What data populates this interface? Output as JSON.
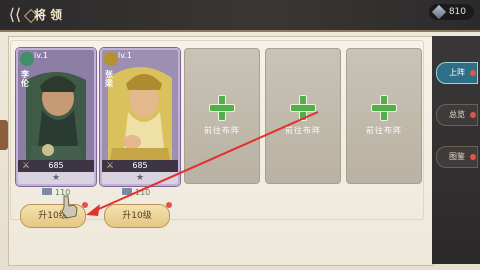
{
  "header": {
    "title": "将领",
    "back_icon": "back-arrow-icon",
    "currency": {
      "icon": "silver-gem-icon",
      "value": "810"
    }
  },
  "heroes": [
    {
      "level": "lv.1",
      "faction_badge": "",
      "name": "李伦",
      "power": "685",
      "stars": "★",
      "badge_color": "#3f8f6a",
      "indicator": "110",
      "upgrade_label": "升10级"
    },
    {
      "level": "lv.1",
      "faction_badge": "",
      "name": "张梁",
      "power": "685",
      "stars": "★",
      "badge_color": "#b5922f",
      "indicator": "110",
      "upgrade_label": "升10级"
    }
  ],
  "empty_slots": [
    {
      "label": "前往布阵"
    },
    {
      "label": "前往布阵"
    },
    {
      "label": "前往布阵"
    }
  ],
  "side_menu": [
    {
      "label": "上阵",
      "active": true
    },
    {
      "label": "总览",
      "active": false
    },
    {
      "label": "图鉴",
      "active": false
    }
  ],
  "colors": {
    "card_frame": "#c4b2d6",
    "plus": "#4fb04a",
    "guide_arrow": "#e0322c",
    "active_tab": "#2f6f86"
  }
}
